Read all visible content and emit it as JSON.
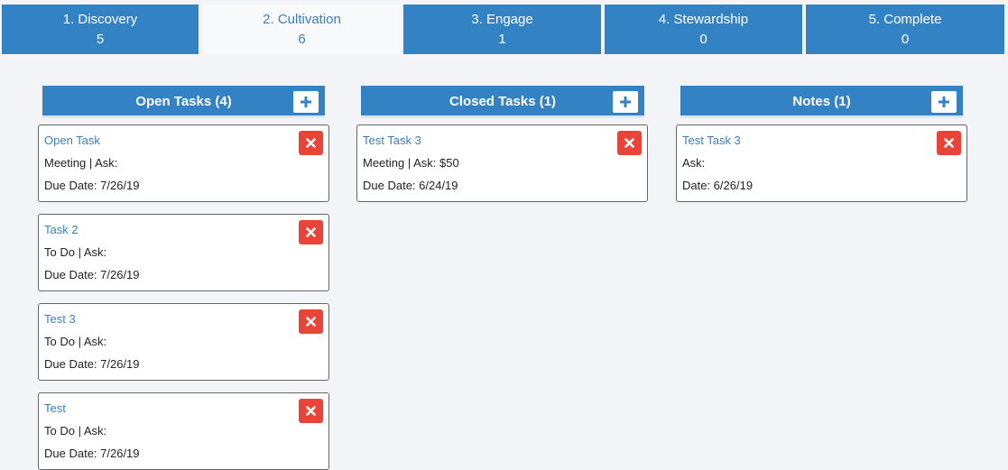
{
  "stages": [
    {
      "name": "1. Discovery",
      "count": "5",
      "active": false
    },
    {
      "name": "2. Cultivation",
      "count": "6",
      "active": true
    },
    {
      "name": "3. Engage",
      "count": "1",
      "active": false
    },
    {
      "name": "4. Stewardship",
      "count": "0",
      "active": false
    },
    {
      "name": "5. Complete",
      "count": "0",
      "active": false
    }
  ],
  "columns": {
    "open_tasks": {
      "title": "Open Tasks (4)",
      "add_icon": "plus-icon",
      "cards": [
        {
          "title": "Open Task",
          "line1": "Meeting | Ask:",
          "line2": "Due Date: 7/26/19"
        },
        {
          "title": "Task 2",
          "line1": "To Do | Ask:",
          "line2": "Due Date: 7/26/19"
        },
        {
          "title": "Test 3",
          "line1": "To Do | Ask:",
          "line2": "Due Date: 7/26/19"
        },
        {
          "title": "Test",
          "line1": "To Do | Ask:",
          "line2": "Due Date: 7/26/19"
        }
      ]
    },
    "closed_tasks": {
      "title": "Closed Tasks (1)",
      "add_icon": "plus-icon",
      "cards": [
        {
          "title": "Test Task 3",
          "line1": "Meeting | Ask: $50",
          "line2": "Due Date: 6/24/19"
        }
      ]
    },
    "notes": {
      "title": "Notes (1)",
      "add_icon": "plus-icon",
      "cards": [
        {
          "title": "Test Task 3",
          "line1": "Ask:",
          "line2": "Date: 6/26/19"
        }
      ]
    }
  },
  "delete_icon": "close-icon",
  "colors": {
    "accent": "#3282c4",
    "link": "#3a7fba",
    "delete": "#e9443a",
    "background": "#f3f4f8"
  }
}
